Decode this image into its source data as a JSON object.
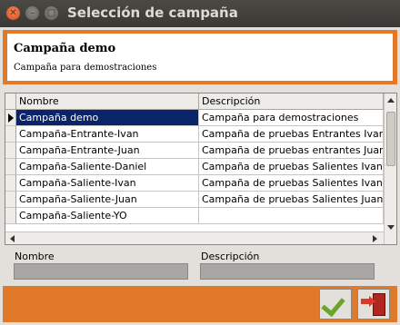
{
  "window": {
    "title": "Selección de campaña"
  },
  "header": {
    "title": "Campaña demo",
    "subtitle": "Campaña para demostraciones"
  },
  "table": {
    "columns": [
      "Nombre",
      "Descripción"
    ],
    "rows": [
      {
        "name": "Campaña demo",
        "description": "Campaña para demostraciones",
        "selected": true
      },
      {
        "name": "Campaña-Entrante-Ivan",
        "description": "Campaña de pruebas Entrantes Ivan"
      },
      {
        "name": "Campaña-Entrante-Juan",
        "description": "Campaña de pruebas entrantes Juan"
      },
      {
        "name": "Campaña-Saliente-Daniel",
        "description": "Campaña de pruebas Salientes Ivan"
      },
      {
        "name": "Campaña-Saliente-Ivan",
        "description": "Campaña de pruebas Salientes Ivan"
      },
      {
        "name": "Campaña-Saliente-Juan",
        "description": "Campaña de pruebas Salientes Juan"
      },
      {
        "name": "Campaña-Saliente-YO",
        "description": ""
      }
    ]
  },
  "form": {
    "name_label": "Nombre",
    "description_label": "Descripción",
    "name_value": "",
    "description_value": ""
  },
  "colors": {
    "accent": "#e07a2a",
    "selection": "#0a246a"
  },
  "icons": {
    "ok": "checkmark-icon",
    "exit": "exit-door-icon"
  }
}
